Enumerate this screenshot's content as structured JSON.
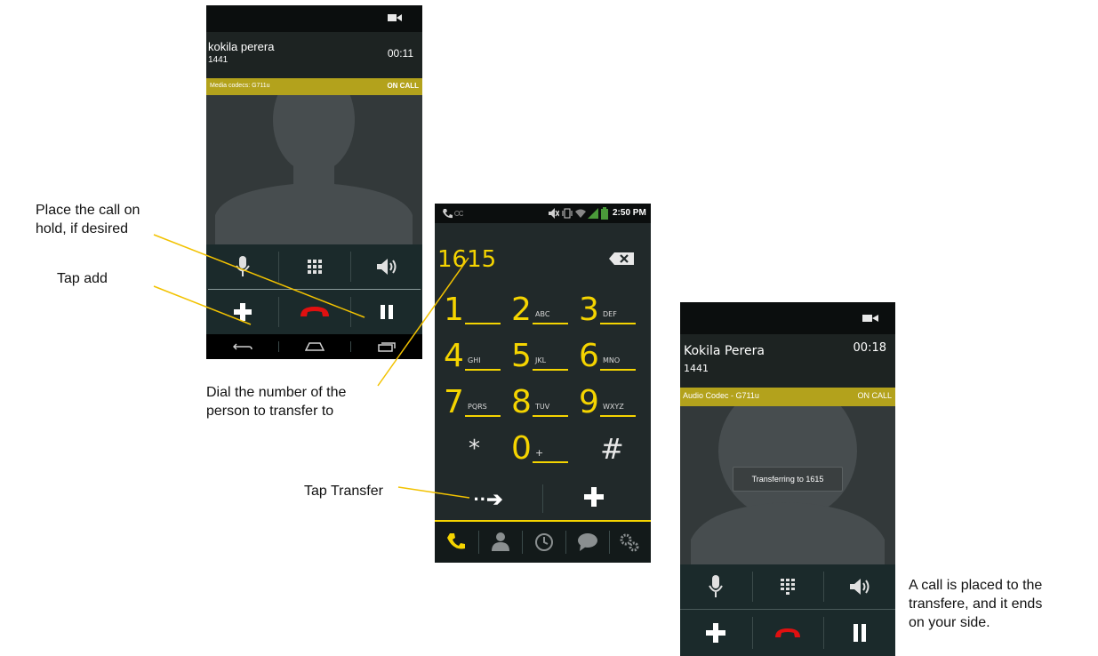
{
  "phone1": {
    "caller_name": "kokila perera",
    "caller_number": "1441",
    "duration": "00:11",
    "codec": "Media codecs: G711u",
    "call_status": "ON CALL",
    "icons": {
      "mic": "microphone-icon",
      "keypad": "keypad-icon",
      "speaker": "speaker-icon",
      "add": "plus-icon",
      "end": "end-call-icon",
      "hold": "pause-icon",
      "back": "back-icon",
      "home": "home-icon",
      "recents": "recents-icon"
    }
  },
  "phone2": {
    "status_time": "2:50 PM",
    "dialed_number": "1615",
    "keys": [
      {
        "num": "1",
        "sub": ""
      },
      {
        "num": "2",
        "sub": "ABC"
      },
      {
        "num": "3",
        "sub": "DEF"
      },
      {
        "num": "4",
        "sub": "GHI"
      },
      {
        "num": "5",
        "sub": "JKL"
      },
      {
        "num": "6",
        "sub": "MNO"
      },
      {
        "num": "7",
        "sub": "PQRS"
      },
      {
        "num": "8",
        "sub": "TUV"
      },
      {
        "num": "9",
        "sub": "WXYZ"
      },
      {
        "num": "*",
        "sub": ""
      },
      {
        "num": "0",
        "sub": "+"
      },
      {
        "num": "#",
        "sub": ""
      }
    ],
    "transfer_glyph": "··➔",
    "plus_glyph": "+"
  },
  "phone3": {
    "caller_name": "Kokila Perera",
    "caller_number": "1441",
    "duration": "00:18",
    "codec": "Audio Codec - G711u",
    "call_status": "ON CALL",
    "toast": "Transferring to 1615"
  },
  "annotations": {
    "hold_line1": "Place the call on",
    "hold_line2": "hold, if desired",
    "tap_add": "Tap add",
    "dial_line1": "Dial the number of the",
    "dial_line2": "person to transfer to",
    "tap_transfer": "Tap Transfer",
    "result_line1": "A call is placed to the",
    "result_line2": "transfere, and it ends",
    "result_line3": "on your side."
  },
  "colors": {
    "accent_yellow": "#f5d400",
    "codec_bar": "#b3a21c",
    "end_call_red": "#e01010",
    "callout_line": "#f2c200"
  }
}
